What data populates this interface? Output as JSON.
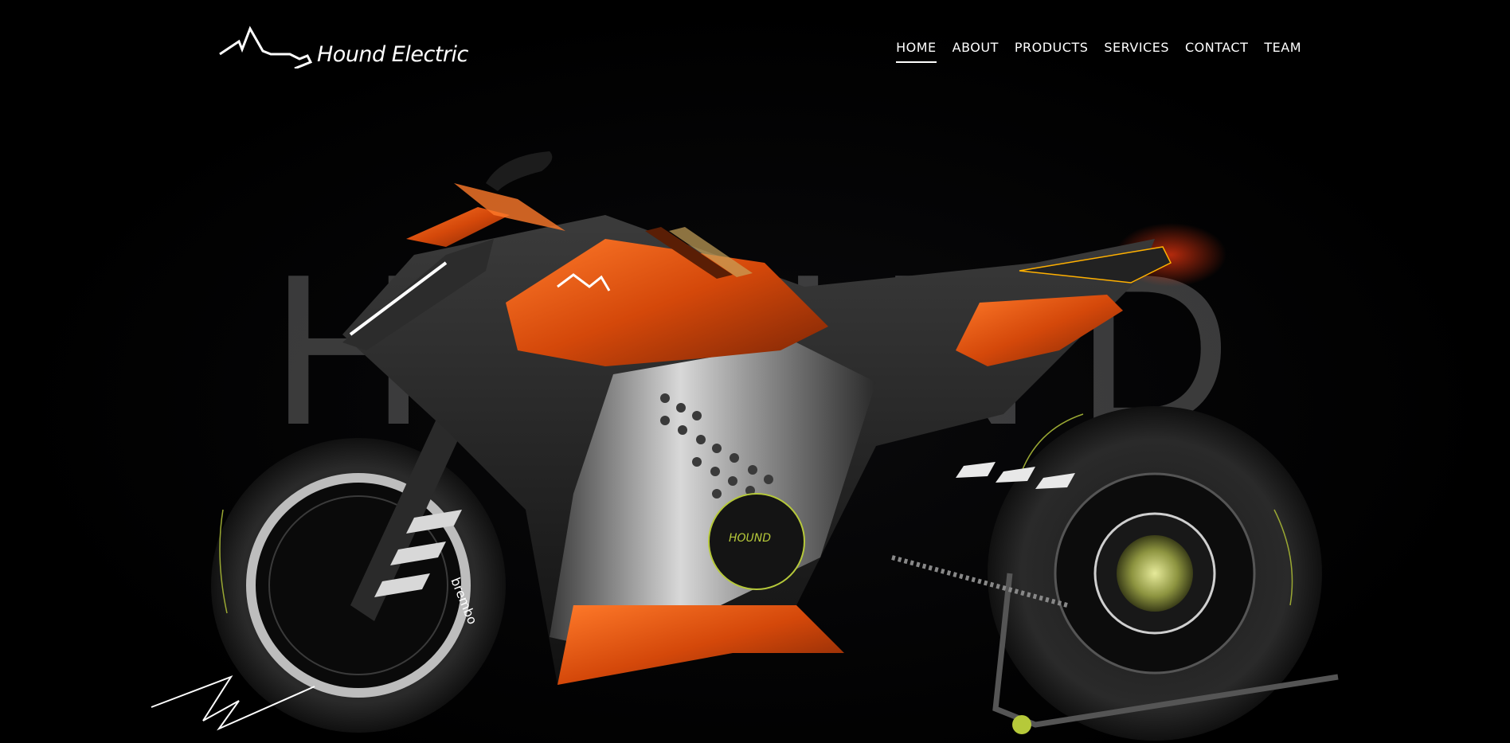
{
  "header": {
    "logo_text": "Hound Electric"
  },
  "nav": {
    "items": [
      {
        "label": "HOME",
        "active": true
      },
      {
        "label": "ABOUT",
        "active": false
      },
      {
        "label": "PRODUCTS",
        "active": false
      },
      {
        "label": "SERVICES",
        "active": false
      },
      {
        "label": "CONTACT",
        "active": false
      },
      {
        "label": "TEAM",
        "active": false
      }
    ]
  },
  "hero": {
    "background_text": "HOUND",
    "bike_tank_badge": "",
    "bike_motor_label": "HOUND",
    "bike_brake_label": "brembo"
  },
  "colors": {
    "background": "#000000",
    "accent_orange": "#e0560f",
    "accent_lime": "#b6c93a",
    "text": "#ffffff"
  },
  "icons": {
    "logo": "hound-electric-logo-icon",
    "signature": "signature-icon"
  }
}
